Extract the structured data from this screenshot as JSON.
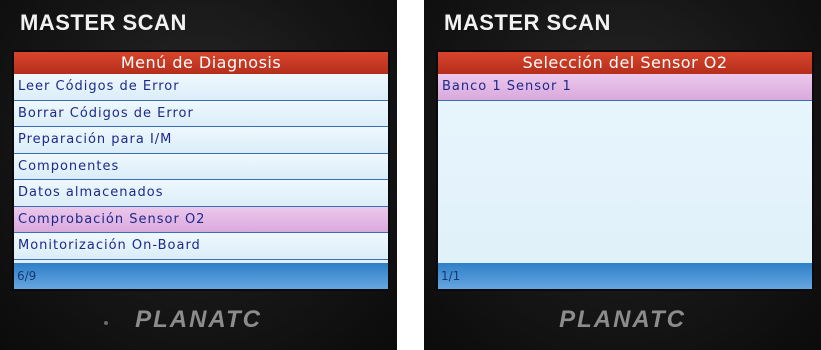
{
  "left_device": {
    "brand": "MASTER SCAN",
    "screen_title": "Menú de Diagnosis",
    "menu_items": [
      "Leer Códigos de Error",
      "Borrar Códigos de Error",
      "Preparación para I/M",
      "Componentes",
      "Datos almacenados",
      "Comprobación Sensor O2",
      "Monitorización On-Board"
    ],
    "selected_item": "Comprobación Sensor O2",
    "pager": "6/9",
    "vendor_logo": "PLANATC"
  },
  "right_device": {
    "brand": "MASTER SCAN",
    "screen_title": "Selección del Sensor O2",
    "menu_items": [
      "Banco 1 Sensor 1"
    ],
    "selected_item": "Banco 1 Sensor 1",
    "pager": "1/1",
    "vendor_logo": "PLANATC"
  },
  "colors": {
    "title_bar": "#c8391f",
    "selected_row": "#e1b4e2",
    "row_text": "#1d2a8c",
    "footer_bar": "#3f8ed4"
  }
}
